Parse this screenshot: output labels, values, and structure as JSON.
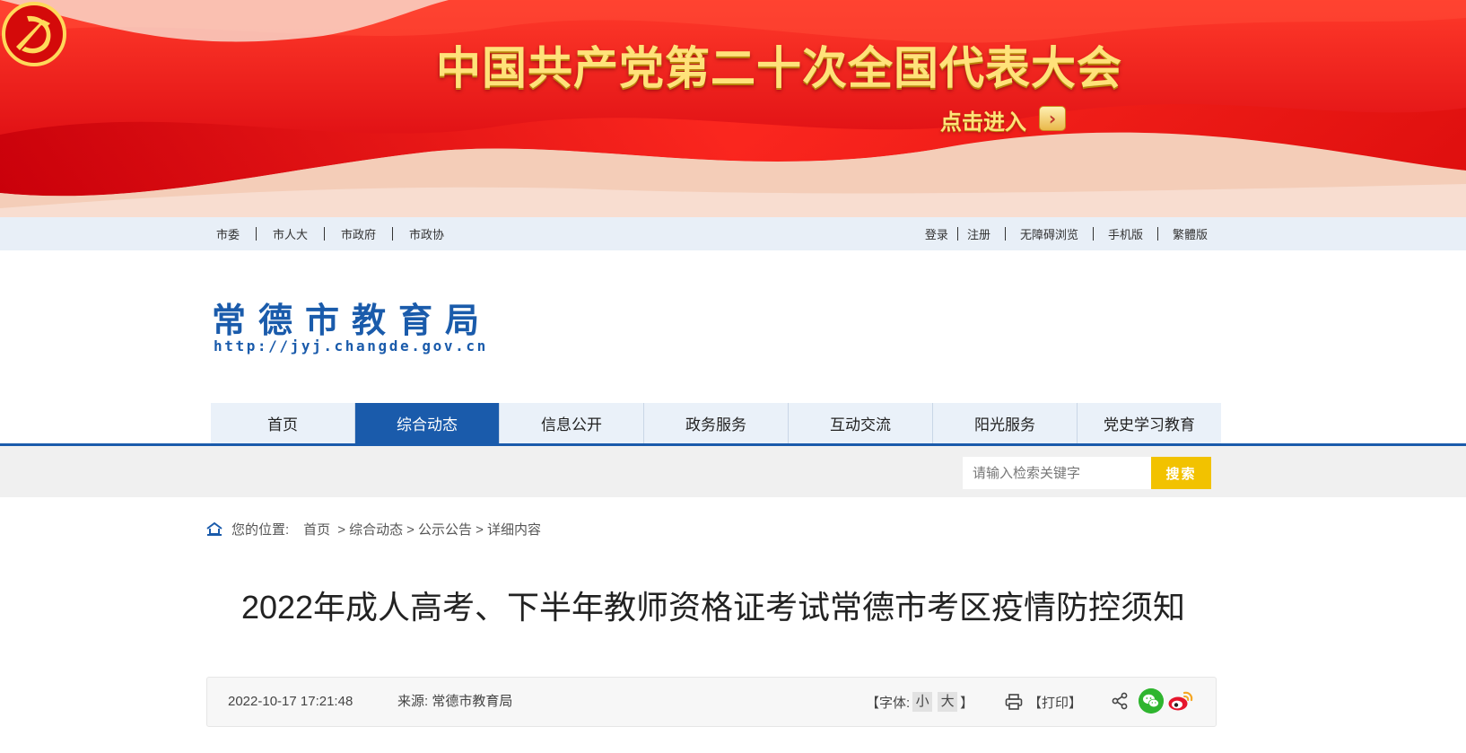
{
  "banner": {
    "title": "中国共产党第二十次全国代表大会",
    "enter_label": "点击进入",
    "arrow_glyph": "›",
    "emblem_icon": "party-emblem-icon"
  },
  "topbar": {
    "left_links": [
      "市委",
      "市人大",
      "市政府",
      "市政协"
    ],
    "right_links": [
      "登录",
      "注册",
      "无障碍浏览",
      "手机版",
      "繁體版"
    ]
  },
  "logo": {
    "title": "常德市教育局",
    "url": "http://jyj.changde.gov.cn"
  },
  "nav": {
    "items": [
      "首页",
      "综合动态",
      "信息公开",
      "政务服务",
      "互动交流",
      "阳光服务",
      "党史学习教育"
    ],
    "active_index": 1
  },
  "search": {
    "placeholder": "请输入检索关键字",
    "button_label": "搜索"
  },
  "breadcrumb": {
    "label": "您的位置:",
    "home": "首页",
    "items": [
      "> 综合动态",
      "> 公示公告",
      "> 详细内容"
    ]
  },
  "article": {
    "title": "2022年成人高考、下半年教师资格证考试常德市考区疫情防控须知",
    "date": "2022-10-17 17:21:48",
    "source_label": "来源:",
    "source": "常德市教育局",
    "font_open": "【字体:",
    "font_small": "小",
    "font_large": "大",
    "font_close": "】",
    "print_label": "【打印】"
  },
  "colors": {
    "brand_blue": "#1a5bab",
    "search_yellow": "#f2c200",
    "banner_red": "#e01414",
    "banner_gold": "#ffe27a"
  }
}
